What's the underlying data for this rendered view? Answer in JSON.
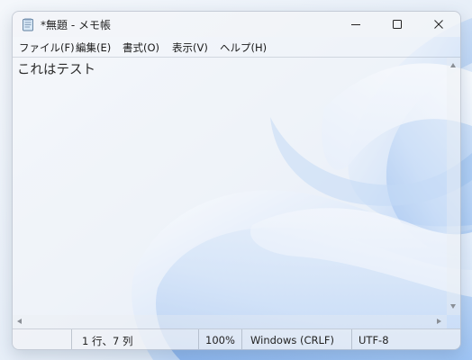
{
  "window": {
    "title": "*無題 - メモ帳"
  },
  "menu": {
    "items": [
      {
        "label": "ファイル(F)"
      },
      {
        "label": "編集(E)"
      },
      {
        "label": "書式(O)"
      },
      {
        "label": "表示(V)"
      },
      {
        "label": "ヘルプ(H)"
      }
    ]
  },
  "editor": {
    "content": "これはテスト"
  },
  "status": {
    "position": "1 行、7 列",
    "zoom": "100%",
    "line_ending": "Windows (CRLF)",
    "encoding": "UTF-8"
  },
  "icons": {
    "app": "notepad-icon",
    "minimize": "minimize-icon",
    "maximize": "maximize-icon",
    "close": "close-icon"
  },
  "colors": {
    "wallpaper_light": "#eef3f9",
    "wallpaper_blue": "#7fb0ee",
    "text": "#222222"
  }
}
